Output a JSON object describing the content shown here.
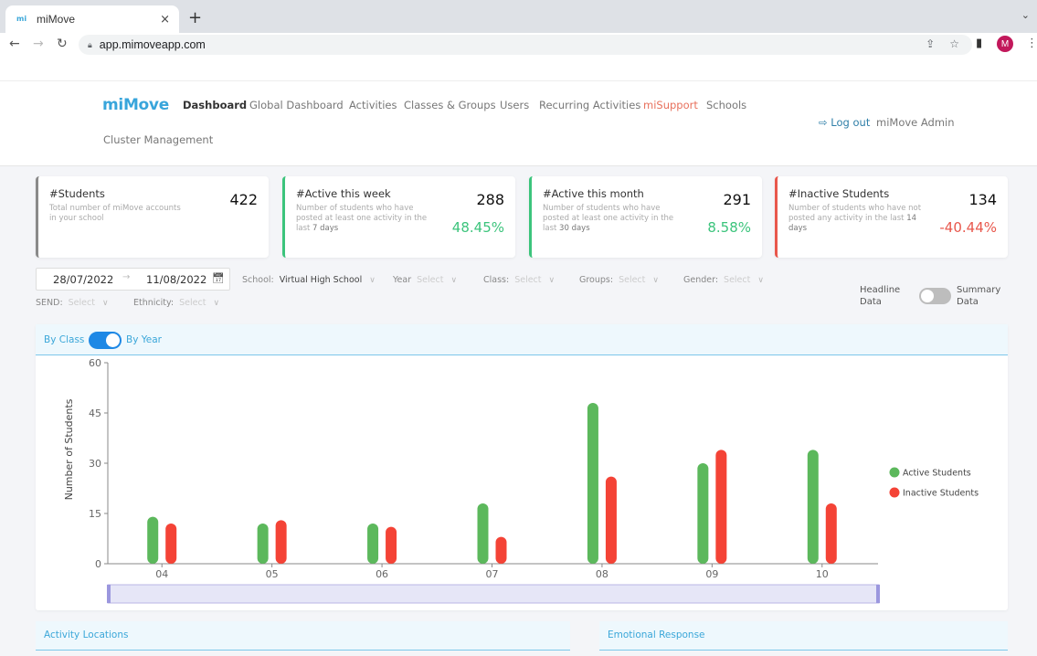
{
  "browser": {
    "tab_title": "miMove",
    "new_tab": "+",
    "tab_close": "×",
    "url": "app.mimoveapp.com",
    "profile_initial": "M"
  },
  "header": {
    "logo": "miMove",
    "nav": [
      "Dashboard",
      "Global Dashboard",
      "Activities",
      "Classes & Groups",
      "Users",
      "Recurring Activities",
      "miSupport",
      "Schools",
      "Cluster Management"
    ],
    "active_nav": "Dashboard",
    "logout": "Log out",
    "user": "miMove Admin"
  },
  "cards": [
    {
      "title": "#Students",
      "desc_pre": "Total number of miMove accounts in your school",
      "desc_bold": "",
      "value": "422",
      "percent": "",
      "accent": "#8a8a8a",
      "percent_color": ""
    },
    {
      "title": "#Active this week",
      "desc_pre": "Number of students who have posted at least one activity in the last ",
      "desc_bold": "7 days",
      "value": "288",
      "percent": "48.45%",
      "accent": "#3cc47c",
      "percent_color": "#3cc47c"
    },
    {
      "title": "#Active this month",
      "desc_pre": "Number of students who have posted at least one activity in the last ",
      "desc_bold": "30 days",
      "value": "291",
      "percent": "8.58%",
      "accent": "#3cc47c",
      "percent_color": "#3cc47c"
    },
    {
      "title": "#Inactive Students",
      "desc_pre": "Number of students who have not posted any activity in the last ",
      "desc_bold": "14 days",
      "value": "134",
      "percent": "-40.44%",
      "accent": "#e8574c",
      "percent_color": "#e8574c"
    }
  ],
  "filters": {
    "date_from": "28/07/2022",
    "date_to": "11/08/2022",
    "school_label": "School:",
    "school_value": "Virtual High School",
    "year_label": "Year",
    "class_label": "Class:",
    "groups_label": "Groups:",
    "gender_label": "Gender:",
    "send_label": "SEND:",
    "ethnicity_label": "Ethnicity:",
    "placeholder": "Select",
    "headline_label": "Headline Data",
    "summary_label": "Summary Data",
    "summary_on": false
  },
  "chart_panel": {
    "by_class": "By Class",
    "by_year": "By Year",
    "by_year_on": true
  },
  "chart_data": {
    "type": "bar",
    "title": "",
    "xlabel": "",
    "ylabel": "Number of Students",
    "ylim": [
      0,
      60
    ],
    "yticks": [
      0,
      15,
      30,
      45,
      60
    ],
    "categories": [
      "04",
      "05",
      "06",
      "07",
      "08",
      "09",
      "10"
    ],
    "series": [
      {
        "name": "Active Students",
        "color": "#5cb85c",
        "values": [
          14,
          12,
          12,
          18,
          48,
          30,
          34
        ]
      },
      {
        "name": "Inactive Students",
        "color": "#f44336",
        "values": [
          12,
          13,
          11,
          8,
          26,
          34,
          18
        ]
      }
    ],
    "legend": "right",
    "grid": false
  },
  "sections": {
    "activity_locations": "Activity Locations",
    "emotional_response": "Emotional Response"
  }
}
